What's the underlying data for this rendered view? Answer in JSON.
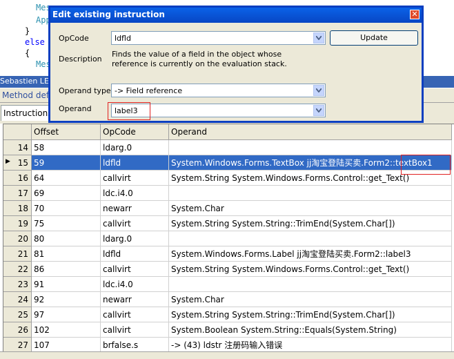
{
  "code_lines": {
    "l1": "Mes",
    "l2": "App",
    "l3": "}",
    "l4": "else",
    "l5": "{",
    "l6": "Mes"
  },
  "strip": {
    "text": "Sebastien LEB"
  },
  "tabstrip": {
    "text": "Method defin"
  },
  "instructions_tab": {
    "label": "Instructions"
  },
  "dialog": {
    "title": "Edit existing instruction",
    "close_glyph": "✕",
    "opcode_label": "OpCode",
    "opcode_value": "ldfld",
    "update_label": "Update",
    "description_label": "Description",
    "description_text": "Finds the value of a field in the object whose reference is currently on the evaluation stack.",
    "operand_type_label": "Operand type",
    "operand_type_value": "-> Field reference",
    "operand_label": "Operand",
    "operand_value": "label3"
  },
  "grid": {
    "columns": [
      "Offset",
      "OpCode",
      "Operand"
    ],
    "rows": [
      {
        "n": "14",
        "offset": "58",
        "opcode": "ldarg.0",
        "operand": ""
      },
      {
        "n": "15",
        "offset": "59",
        "opcode": "ldfld",
        "operand": "System.Windows.Forms.TextBox jj淘宝登陆买卖.Form2::textBox1",
        "selected": true
      },
      {
        "n": "16",
        "offset": "64",
        "opcode": "callvirt",
        "operand": "System.String System.Windows.Forms.Control::get_Text()"
      },
      {
        "n": "17",
        "offset": "69",
        "opcode": "ldc.i4.0",
        "operand": ""
      },
      {
        "n": "18",
        "offset": "70",
        "opcode": "newarr",
        "operand": "System.Char"
      },
      {
        "n": "19",
        "offset": "75",
        "opcode": "callvirt",
        "operand": "System.String System.String::TrimEnd(System.Char[])"
      },
      {
        "n": "20",
        "offset": "80",
        "opcode": "ldarg.0",
        "operand": ""
      },
      {
        "n": "21",
        "offset": "81",
        "opcode": "ldfld",
        "operand": "System.Windows.Forms.Label jj淘宝登陆买卖.Form2::label3"
      },
      {
        "n": "22",
        "offset": "86",
        "opcode": "callvirt",
        "operand": "System.String System.Windows.Forms.Control::get_Text()"
      },
      {
        "n": "23",
        "offset": "91",
        "opcode": "ldc.i4.0",
        "operand": ""
      },
      {
        "n": "24",
        "offset": "92",
        "opcode": "newarr",
        "operand": "System.Char"
      },
      {
        "n": "25",
        "offset": "97",
        "opcode": "callvirt",
        "operand": "System.String System.String::TrimEnd(System.Char[])"
      },
      {
        "n": "26",
        "offset": "102",
        "opcode": "callvirt",
        "operand": "System.Boolean System.String::Equals(System.String)"
      },
      {
        "n": "27",
        "offset": "107",
        "opcode": "brfalse.s",
        "operand": "-> (43) ldstr 注册码输入错误"
      }
    ]
  },
  "colors": {
    "selection": "#316ac5",
    "title_bar": "#0a62e8",
    "highlight_box": "#e02020"
  }
}
